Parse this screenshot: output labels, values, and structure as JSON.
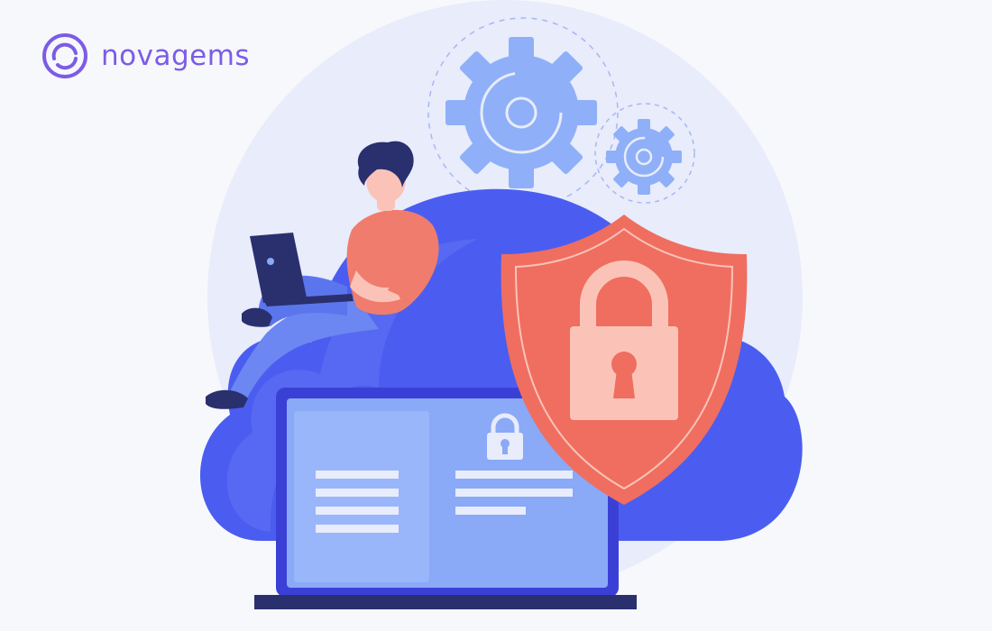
{
  "brand": {
    "name": "novagems",
    "logo_icon": "ring-logo-icon",
    "color": "#7c5ce6"
  },
  "illustration": {
    "subject": "cloud-security",
    "icons": [
      "gear-icon",
      "shield-icon",
      "padlock-icon",
      "laptop-icon",
      "person-icon",
      "cloud-icon"
    ]
  },
  "colors": {
    "background": "#f7f8fc",
    "halo": "#e8ecfb",
    "cloud": "#4b5df0",
    "cloud_light": "#6272f4",
    "gear": "#8fb0f8",
    "shield": "#ef6e60",
    "lock": "#fbc3b8",
    "laptop_frame": "#3a40d6",
    "laptop_screen": "#8aa9f7",
    "person_shirt": "#f07c6d",
    "person_hair": "#2a2f6e"
  }
}
